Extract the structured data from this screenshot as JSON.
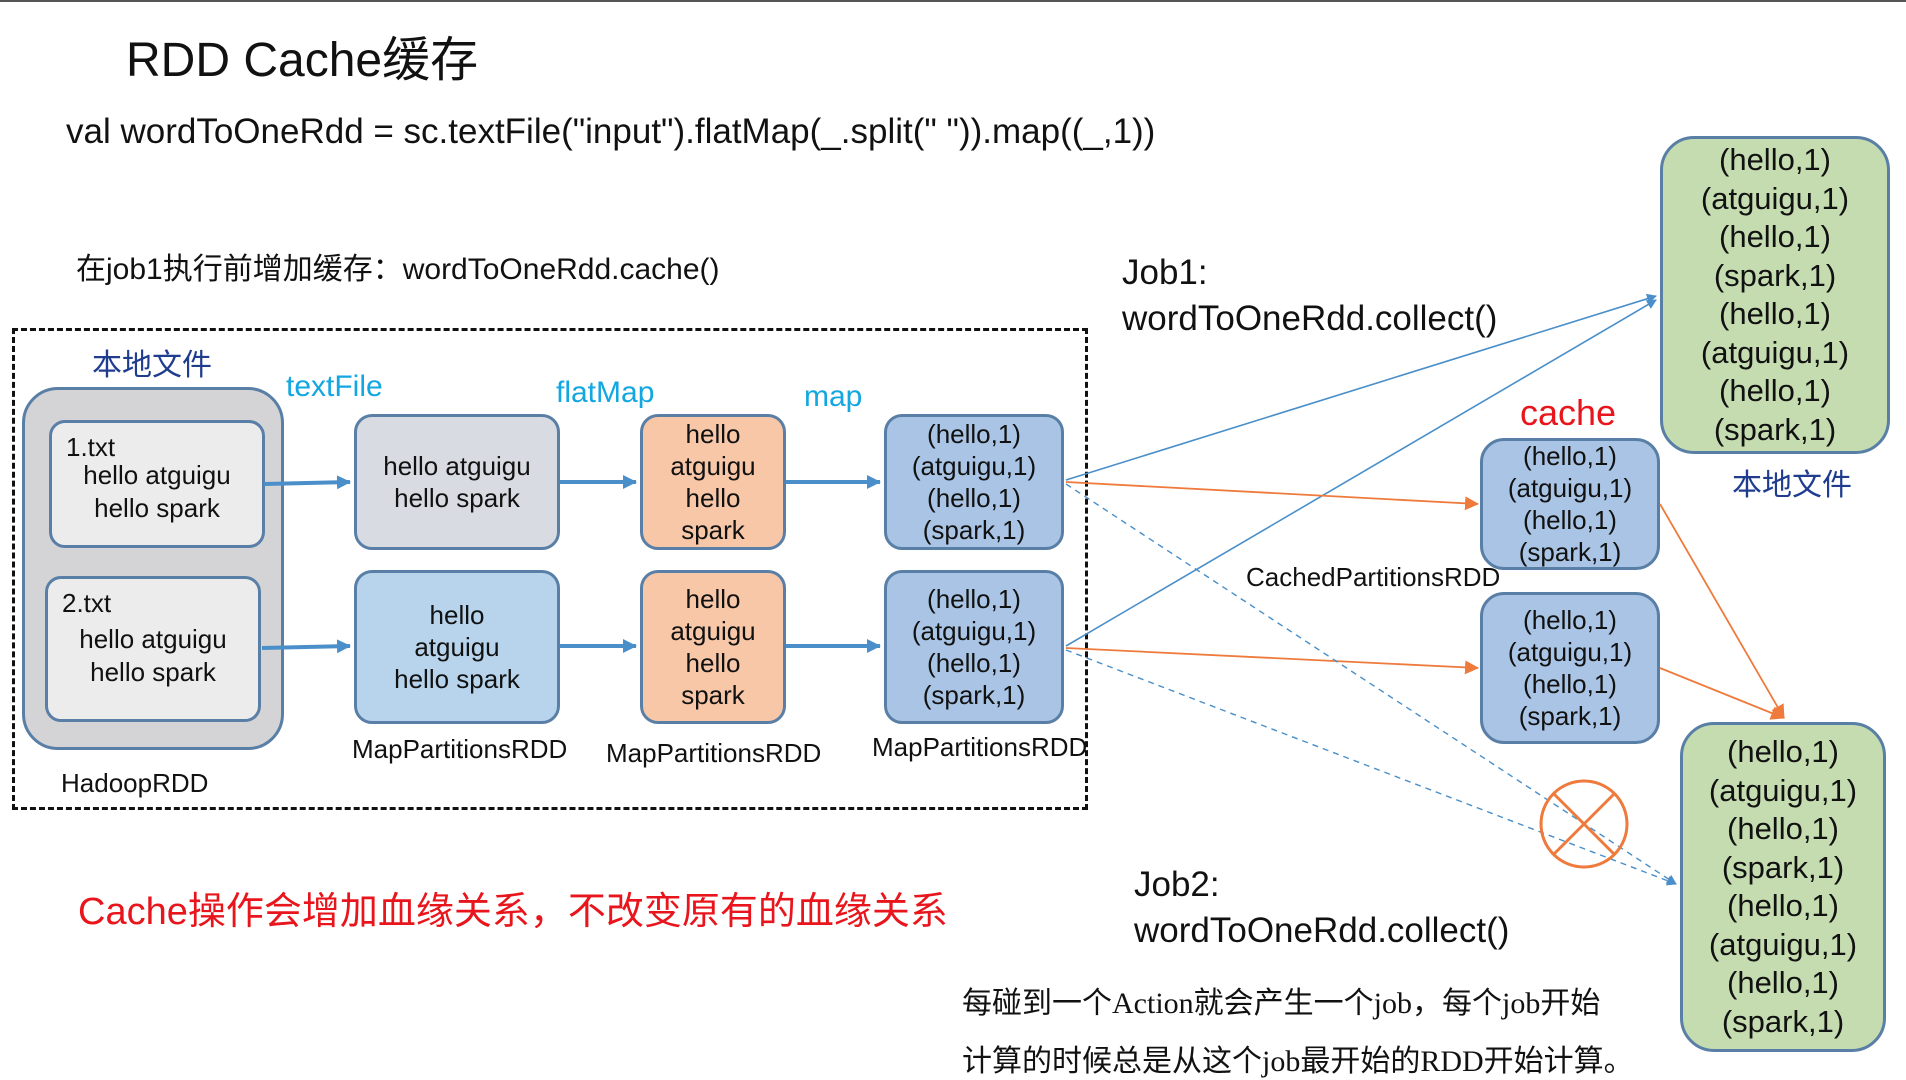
{
  "title": "RDD Cache缓存",
  "code_line": "val wordToOneRdd = sc.textFile(\"input\").flatMap(_.split(\" \")).map((_,1))",
  "note_before_job": "在job1执行前增加缓存：wordToOneRdd.cache()",
  "local_file_label": "本地文件",
  "ops": {
    "textFile": "textFile",
    "flatMap": "flatMap",
    "map": "map"
  },
  "hadoop": {
    "label": "HadoopRDD",
    "files": [
      {
        "name": "1.txt",
        "lines": [
          "hello atguigu",
          "hello spark"
        ]
      },
      {
        "name": "2.txt",
        "lines": [
          "hello atguigu",
          "hello spark"
        ]
      }
    ]
  },
  "textfile_rdd": {
    "label": "MapPartitionsRDD",
    "partitions": [
      {
        "lines": [
          "hello atguigu",
          "hello spark"
        ]
      },
      {
        "lines": [
          "hello",
          "atguigu",
          "hello spark"
        ]
      }
    ]
  },
  "flatmap_rdd": {
    "label": "MapPartitionsRDD",
    "partitions": [
      {
        "lines": [
          "hello",
          "atguigu",
          "hello",
          "spark"
        ]
      },
      {
        "lines": [
          "hello",
          "atguigu",
          "hello",
          "spark"
        ]
      }
    ]
  },
  "map_rdd": {
    "label": "MapPartitionsRDD",
    "partitions": [
      {
        "lines": [
          "(hello,1)",
          "(atguigu,1)",
          "(hello,1)",
          "(spark,1)"
        ]
      },
      {
        "lines": [
          "(hello,1)",
          "(atguigu,1)",
          "(hello,1)",
          "(spark,1)"
        ]
      }
    ]
  },
  "cache_label": "cache",
  "cached_rdd": {
    "label": "CachedPartitionsRDD",
    "partitions": [
      {
        "lines": [
          "(hello,1)",
          "(atguigu,1)",
          "(hello,1)",
          "(spark,1)"
        ]
      },
      {
        "lines": [
          "(hello,1)",
          "(atguigu,1)",
          "(hello,1)",
          "(spark,1)"
        ]
      }
    ]
  },
  "job1": {
    "line1": "Job1:",
    "line2": "wordToOneRdd.collect()"
  },
  "job2": {
    "line1": "Job2:",
    "line2": "wordToOneRdd.collect()"
  },
  "result1": {
    "label": "本地文件",
    "lines": [
      "(hello,1)",
      "(atguigu,1)",
      "(hello,1)",
      "(spark,1)",
      "(hello,1)",
      "(atguigu,1)",
      "(hello,1)",
      "(spark,1)"
    ]
  },
  "result2": {
    "lines": [
      "(hello,1)",
      "(atguigu,1)",
      "(hello,1)",
      "(spark,1)",
      "(hello,1)",
      "(atguigu,1)",
      "(hello,1)",
      "(spark,1)"
    ]
  },
  "red_note": "Cache操作会增加血缘关系，不改变原有的血缘关系",
  "bottom_note": {
    "line1": "每碰到一个Action就会产生一个job，每个job开始",
    "line2": "计算的时候总是从这个job最开始的RDD开始计算。"
  },
  "colors": {
    "blue_arrow": "#4a8fc9",
    "orange_arrow": "#ee7a3c",
    "red_text": "#e8161c",
    "op_text": "#12a7e0",
    "green_box": "#c5dcb1",
    "orange_box": "#f7c7a8",
    "blue_box": "#a9c4e4"
  },
  "icons": {
    "blocked_marker": "circle-x-icon"
  }
}
